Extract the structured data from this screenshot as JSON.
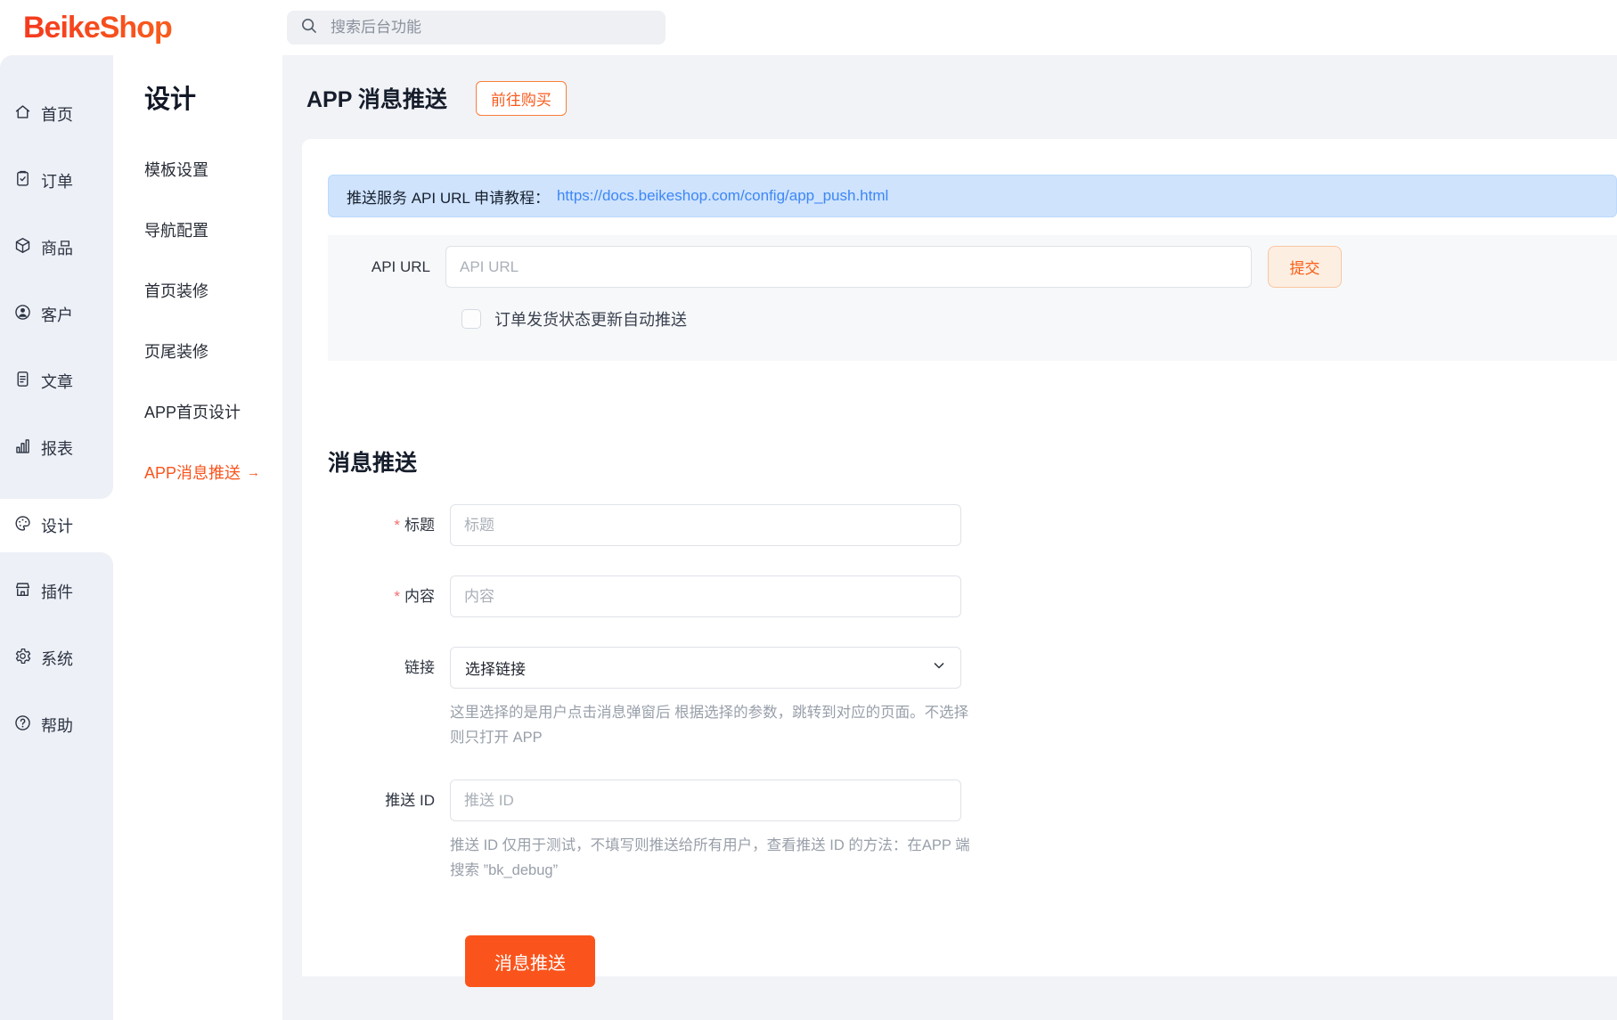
{
  "header": {
    "logo": "BeikeShop",
    "search_placeholder": "搜索后台功能"
  },
  "icon_sidebar": {
    "items": [
      {
        "label": "首页",
        "icon": "home-icon"
      },
      {
        "label": "订单",
        "icon": "order-icon"
      },
      {
        "label": "商品",
        "icon": "product-icon"
      },
      {
        "label": "客户",
        "icon": "customer-icon"
      },
      {
        "label": "文章",
        "icon": "article-icon"
      },
      {
        "label": "报表",
        "icon": "report-icon"
      },
      {
        "label": "设计",
        "icon": "design-icon",
        "active": true
      },
      {
        "label": "插件",
        "icon": "plugin-icon"
      },
      {
        "label": "系统",
        "icon": "system-icon"
      },
      {
        "label": "帮助",
        "icon": "help-icon"
      }
    ]
  },
  "submenu": {
    "title": "设计",
    "items": [
      "模板设置",
      "导航配置",
      "首页装修",
      "页尾装修",
      "APP首页设计"
    ],
    "active_item": "APP消息推送",
    "active_arrow": "→"
  },
  "page": {
    "title": "APP 消息推送",
    "buy_button": "前往购买",
    "banner": {
      "text": "推送服务 API URL 申请教程：",
      "link": "https://docs.beikeshop.com/config/app_push.html"
    },
    "api": {
      "label": "API URL",
      "placeholder": "API URL",
      "submit": "提交",
      "checkbox_label": "订单发货状态更新自动推送",
      "checked": false
    },
    "push": {
      "heading": "消息推送",
      "required_marker": "*",
      "title_label": "标题",
      "title_placeholder": "标题",
      "content_label": "内容",
      "content_placeholder": "内容",
      "link_label": "链接",
      "link_value": "选择链接",
      "link_help": "这里选择的是用户点击消息弹窗后 根据选择的参数，跳转到对应的页面。不选择 则只打开 APP",
      "id_label": "推送 ID",
      "id_placeholder": "推送 ID",
      "id_help": "推送 ID 仅用于测试，不填写则推送给所有用户，查看推送 ID 的方法：在APP 端 搜索 ”bk_debug”",
      "submit": "消息推送"
    }
  },
  "colors": {
    "accent": "#fa541c",
    "link_blue": "#3d87f5",
    "banner_bg": "#cfe3fd",
    "sidebar_bg": "#edf0f6"
  }
}
